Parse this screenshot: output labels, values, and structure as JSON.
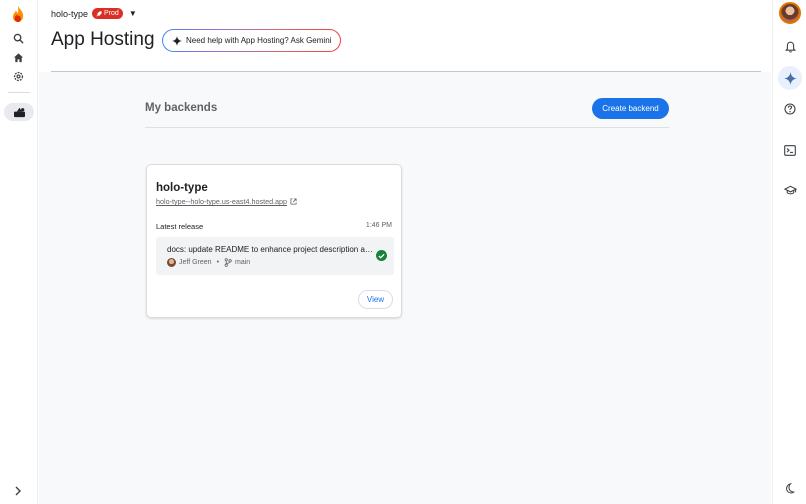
{
  "header": {
    "project_name": "holo-type",
    "env_badge": "Prod",
    "page_title": "App Hosting",
    "gemini_prompt": "Need help with App Hosting? Ask Gemini"
  },
  "backends": {
    "section_title": "My backends",
    "create_label": "Create backend",
    "items": [
      {
        "name": "holo-type",
        "url": "holo-type--holo-type.us-east4.hosted.app",
        "latest_release_label": "Latest release",
        "release_time": "1:46 PM",
        "commit_message": "docs: update README to enhance project description an...",
        "author": "Jeff Green",
        "branch": "main",
        "view_label": "View"
      }
    ]
  },
  "left_nav": {
    "icons": [
      "firebase-logo",
      "search-icon",
      "home-icon",
      "settings-icon",
      "app-hosting-icon",
      "expand-icon"
    ]
  },
  "right_rail": {
    "icons": [
      "user-avatar",
      "notifications-icon",
      "gemini-icon",
      "help-icon",
      "terminal-icon",
      "learn-icon",
      "dark-mode-icon"
    ]
  },
  "colors": {
    "primary": "#1a73e8",
    "badge": "#d93025",
    "success": "#188038",
    "firebase_orange": "#ff9100"
  }
}
